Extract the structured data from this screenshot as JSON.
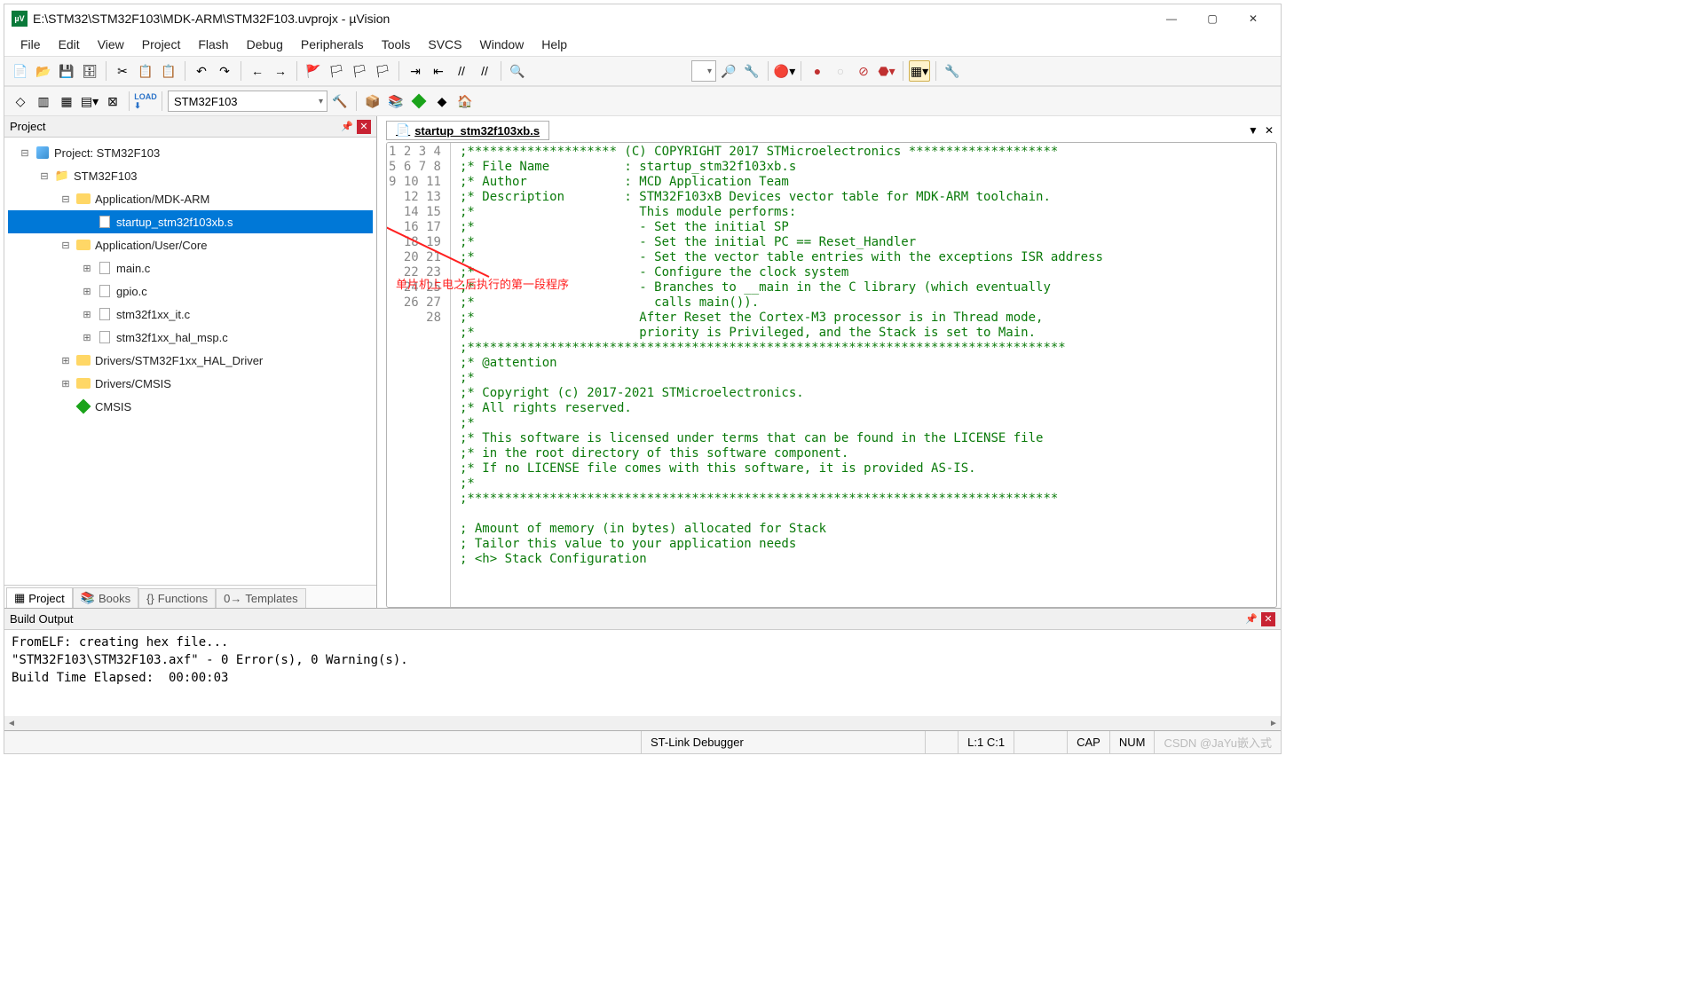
{
  "window": {
    "title": "E:\\STM32\\STM32F103\\MDK-ARM\\STM32F103.uvprojx - µVision"
  },
  "menu": [
    "File",
    "Edit",
    "View",
    "Project",
    "Flash",
    "Debug",
    "Peripherals",
    "Tools",
    "SVCS",
    "Window",
    "Help"
  ],
  "toolbar2": {
    "target": "STM32F103"
  },
  "project_pane": {
    "title": "Project",
    "root": "Project: STM32F103",
    "target": "STM32F103",
    "g1": "Application/MDK-ARM",
    "g1f1": "startup_stm32f103xb.s",
    "g2": "Application/User/Core",
    "g2f1": "main.c",
    "g2f2": "gpio.c",
    "g2f3": "stm32f1xx_it.c",
    "g2f4": "stm32f1xx_hal_msp.c",
    "g3": "Drivers/STM32F1xx_HAL_Driver",
    "g4": "Drivers/CMSIS",
    "g5": "CMSIS",
    "tabs": [
      "Project",
      "Books",
      "Functions",
      "Templates"
    ]
  },
  "editor": {
    "tab": "startup_stm32f103xb.s",
    "lines": [
      ";******************** (C) COPYRIGHT 2017 STMicroelectronics ********************",
      ";* File Name          : startup_stm32f103xb.s",
      ";* Author             : MCD Application Team",
      ";* Description        : STM32F103xB Devices vector table for MDK-ARM toolchain.",
      ";*                      This module performs:",
      ";*                      - Set the initial SP",
      ";*                      - Set the initial PC == Reset_Handler",
      ";*                      - Set the vector table entries with the exceptions ISR address",
      ";*                      - Configure the clock system",
      ";*                      - Branches to __main in the C library (which eventually",
      ";*                        calls main()).",
      ";*                      After Reset the Cortex-M3 processor is in Thread mode,",
      ";*                      priority is Privileged, and the Stack is set to Main.",
      ";********************************************************************************",
      ";* @attention",
      ";*",
      ";* Copyright (c) 2017-2021 STMicroelectronics.",
      ";* All rights reserved.",
      ";*",
      ";* This software is licensed under terms that can be found in the LICENSE file",
      ";* in the root directory of this software component.",
      ";* If no LICENSE file comes with this software, it is provided AS-IS.",
      ";*",
      ";*******************************************************************************",
      "",
      "; Amount of memory (in bytes) allocated for Stack",
      "; Tailor this value to your application needs",
      "; <h> Stack Configuration"
    ]
  },
  "annotation_text": "单片机上电之后执行的第一段程序",
  "build": {
    "title": "Build Output",
    "lines": [
      "FromELF: creating hex file...",
      "\"STM32F103\\STM32F103.axf\" - 0 Error(s), 0 Warning(s).",
      "Build Time Elapsed:  00:00:03"
    ]
  },
  "status": {
    "debugger": "ST-Link Debugger",
    "pos": "L:1 C:1",
    "cap": "CAP",
    "num": "NUM",
    "watermark": "CSDN @JaYu嵌入式"
  }
}
